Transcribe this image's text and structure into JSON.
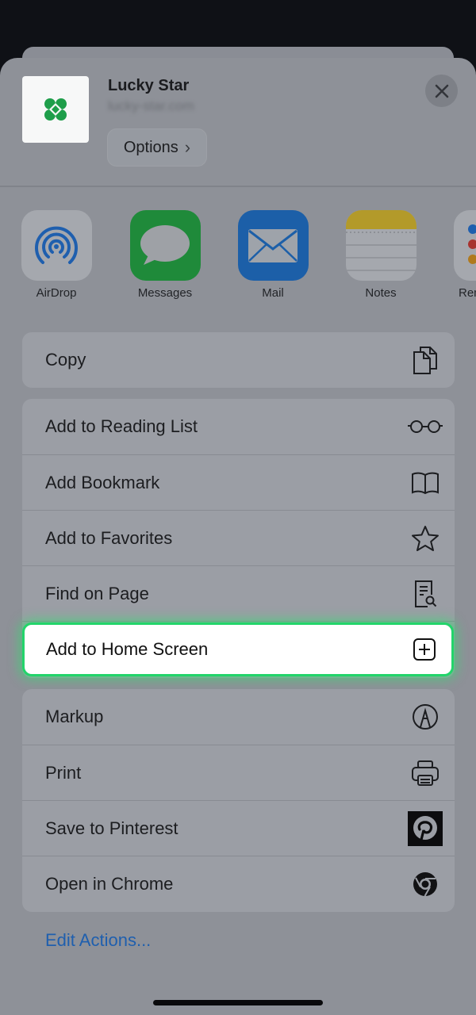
{
  "header": {
    "title": "Lucky Star",
    "url": "lucky-star.com",
    "options_label": "Options",
    "options_chevron": "›"
  },
  "apps": [
    {
      "label": "AirDrop",
      "icon": "airdrop-icon"
    },
    {
      "label": "Messages",
      "icon": "messages-icon"
    },
    {
      "label": "Mail",
      "icon": "mail-icon"
    },
    {
      "label": "Notes",
      "icon": "notes-icon"
    },
    {
      "label": "Reminders",
      "icon": "reminders-icon"
    }
  ],
  "group1": [
    {
      "label": "Copy",
      "icon": "copy-icon"
    }
  ],
  "group2": [
    {
      "label": "Add to Reading List",
      "icon": "glasses-icon"
    },
    {
      "label": "Add Bookmark",
      "icon": "book-icon"
    },
    {
      "label": "Add to Favorites",
      "icon": "star-icon"
    },
    {
      "label": "Find on Page",
      "icon": "find-icon"
    },
    {
      "label": "Add to Home Screen",
      "icon": "plus-square-icon",
      "highlighted": true
    }
  ],
  "group3": [
    {
      "label": "Markup",
      "icon": "markup-icon"
    },
    {
      "label": "Print",
      "icon": "printer-icon"
    },
    {
      "label": "Save to Pinterest",
      "icon": "pinterest-icon"
    },
    {
      "label": "Open in Chrome",
      "icon": "chrome-icon"
    }
  ],
  "edit_actions": "Edit Actions...",
  "colors": {
    "highlight_border": "#22d46a",
    "link": "#1f5fae",
    "logo_green": "#1e9e4a"
  }
}
